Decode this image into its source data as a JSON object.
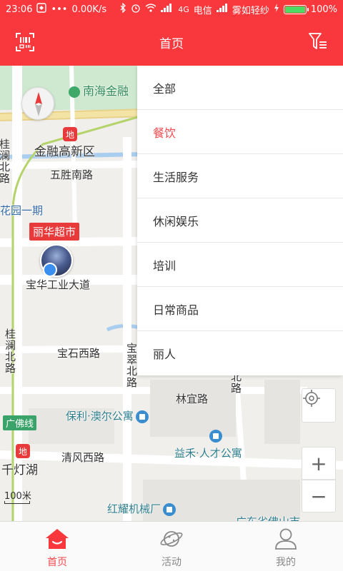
{
  "status_bar": {
    "time": "23:06",
    "network_speed": "0.00K/s",
    "network_type": "4G",
    "carrier": "电信",
    "weather": "雾如轻纱",
    "battery": "100%",
    "battery_level": 1.0
  },
  "header": {
    "title": "首页",
    "scan_icon": "barcode-scan-icon",
    "filter_icon": "filter-list-icon",
    "background_color": "#f8383c"
  },
  "map": {
    "labels": {
      "nanhai_finance": "南海金融",
      "finance_hightech": "金融高新区",
      "wusheng_road": "五胜南路",
      "guilan_north_1": "桂澜北路",
      "garden_phase1": "花园一期",
      "baohua_avenue": "宝华工业大道",
      "guilan_north_2": "桂澜北路",
      "baoshi_west": "宝石西路",
      "baocui_north": "宝翠北路",
      "linyi_road": "林宜路",
      "beilu": "北路",
      "poly_apartment": "保利·澳尔公寓",
      "yihe_apartment": "益禾·人才公寓",
      "guangfo_line": "广佛线",
      "qiandeng_lake": "千灯湖",
      "qingfeng_west": "清风西路",
      "hongyao_factory": "红耀机械厂",
      "guangdong_partial": "广东省佛山市"
    },
    "shop_pin": "丽华超市",
    "scale": "100米",
    "zoom_in": "+",
    "zoom_out": "−"
  },
  "dropdown": {
    "items": [
      {
        "label": "全部",
        "active": false
      },
      {
        "label": "餐饮",
        "active": true
      },
      {
        "label": "生活服务",
        "active": false
      },
      {
        "label": "休闲娱乐",
        "active": false
      },
      {
        "label": "培训",
        "active": false
      },
      {
        "label": "日常商品",
        "active": false
      },
      {
        "label": "丽人",
        "active": false
      }
    ],
    "active_color": "#f24a4e"
  },
  "bottom_nav": {
    "items": [
      {
        "label": "首页",
        "icon": "home-icon",
        "active": true
      },
      {
        "label": "活动",
        "icon": "planet-icon",
        "active": false
      },
      {
        "label": "我的",
        "icon": "user-icon",
        "active": false
      }
    ]
  }
}
